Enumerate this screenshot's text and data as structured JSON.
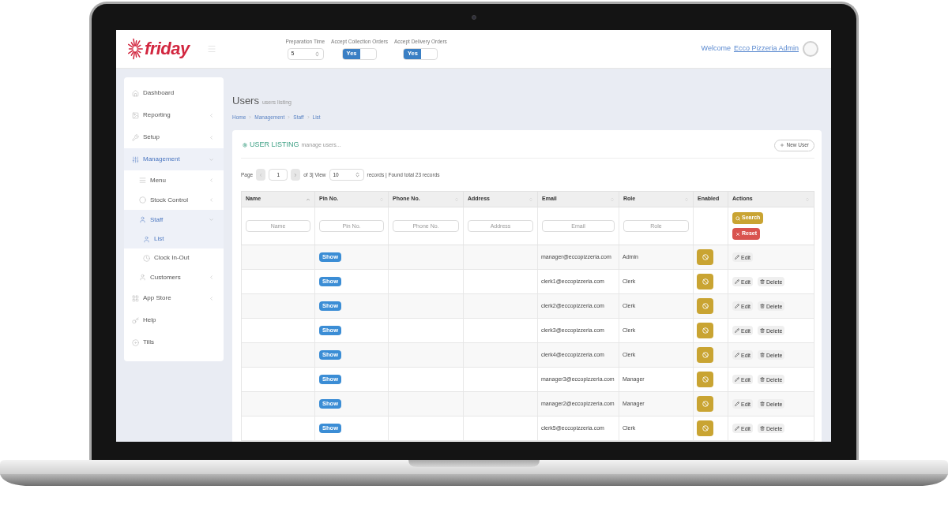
{
  "header": {
    "logo_text": "friday",
    "preparation_time": {
      "label": "Preparation Time",
      "value": "5"
    },
    "toggles": [
      {
        "label": "Accept Collection Orders",
        "on_label": "Yes",
        "on": true
      },
      {
        "label": "Accept Delivery Orders",
        "on_label": "Yes",
        "on": true
      }
    ],
    "welcome": "Welcome",
    "user_link": "Ecco Pizzeria Admin"
  },
  "sidebar": {
    "items": [
      {
        "label": "Dashboard",
        "selected": false
      },
      {
        "label": "Reporting",
        "expanded": false,
        "selected": false
      },
      {
        "label": "Setup",
        "expanded": false,
        "selected": false
      },
      {
        "label": "Management",
        "expanded": true,
        "selected": true,
        "children": [
          {
            "label": "Menu",
            "expanded": false,
            "selected": false
          },
          {
            "label": "Stock Control",
            "expanded": false,
            "selected": false
          },
          {
            "label": "Staff",
            "expanded": true,
            "selected": true,
            "children": [
              {
                "label": "List",
                "selected": true
              },
              {
                "label": "Clock In-Out",
                "selected": false
              }
            ]
          },
          {
            "label": "Customers",
            "expanded": false,
            "selected": false
          }
        ]
      },
      {
        "label": "App Store",
        "expanded": false,
        "selected": false
      },
      {
        "label": "Help",
        "selected": false
      },
      {
        "label": "Tills",
        "selected": false
      }
    ]
  },
  "page": {
    "title": "Users",
    "subtitle": "users listing",
    "breadcrumb": [
      "Home",
      "Management",
      "Staff",
      "List"
    ]
  },
  "panel": {
    "title": "USER LISTING",
    "subtitle": "manage users...",
    "new_button": "New User",
    "pagination": {
      "label": "Page",
      "page": "1",
      "of_text": "of 3| View",
      "per_page": "10",
      "summary": "records | Found total 23 records"
    },
    "table": {
      "columns": [
        {
          "label": "Name",
          "kind": "ascending"
        },
        {
          "label": "Pin No.",
          "kind": "sortable"
        },
        {
          "label": "Phone No.",
          "kind": "sortable"
        },
        {
          "label": "Address",
          "kind": "sortable"
        },
        {
          "label": "Email",
          "kind": "sortable"
        },
        {
          "label": "Role",
          "kind": "sortable"
        },
        {
          "label": "Enabled",
          "kind": "plain"
        },
        {
          "label": "Actions",
          "kind": "sortable"
        }
      ],
      "filters": [
        {
          "placeholder": "Name"
        },
        {
          "placeholder": "Pin No."
        },
        {
          "placeholder": "Phone No."
        },
        {
          "placeholder": "Address"
        },
        {
          "placeholder": "Email"
        },
        {
          "placeholder": "Role"
        }
      ],
      "filter_actions": [
        {
          "kind": "search",
          "label": "Search"
        },
        {
          "kind": "reset",
          "label": "Reset"
        }
      ],
      "rows": [
        {
          "pin": "Show",
          "email": "manager@eccopizzeria.com",
          "role": "Admin",
          "actions": [
            {
              "kind": "edit",
              "label": "Edit"
            }
          ]
        },
        {
          "pin": "Show",
          "email": "clerk1@eccopizzeria.com",
          "role": "Clerk",
          "actions": [
            {
              "kind": "edit",
              "label": "Edit"
            },
            {
              "kind": "delete",
              "label": "Delete"
            }
          ]
        },
        {
          "pin": "Show",
          "email": "clerk2@eccopizzeria.com",
          "role": "Clerk",
          "actions": [
            {
              "kind": "edit",
              "label": "Edit"
            },
            {
              "kind": "delete",
              "label": "Delete"
            }
          ]
        },
        {
          "pin": "Show",
          "email": "clerk3@eccopizzeria.com",
          "role": "Clerk",
          "actions": [
            {
              "kind": "edit",
              "label": "Edit"
            },
            {
              "kind": "delete",
              "label": "Delete"
            }
          ]
        },
        {
          "pin": "Show",
          "email": "clerk4@eccopizzeria.com",
          "role": "Clerk",
          "actions": [
            {
              "kind": "edit",
              "label": "Edit"
            },
            {
              "kind": "delete",
              "label": "Delete"
            }
          ]
        },
        {
          "pin": "Show",
          "email": "manager3@eccopizzeria.com",
          "role": "Manager",
          "actions": [
            {
              "kind": "edit",
              "label": "Edit"
            },
            {
              "kind": "delete",
              "label": "Delete"
            }
          ]
        },
        {
          "pin": "Show",
          "email": "manager2@eccopizzeria.com",
          "role": "Manager",
          "actions": [
            {
              "kind": "edit",
              "label": "Edit"
            },
            {
              "kind": "delete",
              "label": "Delete"
            }
          ]
        },
        {
          "pin": "Show",
          "email": "clerk5@eccopizzeria.com",
          "role": "Clerk",
          "actions": [
            {
              "kind": "edit",
              "label": "Edit"
            },
            {
              "kind": "delete",
              "label": "Delete"
            }
          ]
        }
      ]
    }
  }
}
